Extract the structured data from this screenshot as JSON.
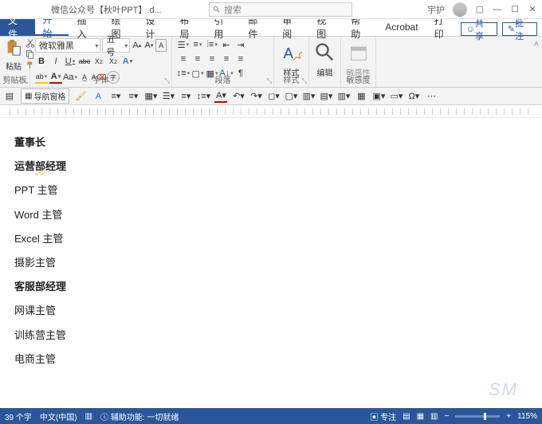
{
  "titlebar": {
    "doc_title": "微信公众号【秋叶PPT】.d...",
    "search_placeholder": "搜索",
    "user_label": "宇护"
  },
  "tabs": {
    "file": "文件",
    "items": [
      "开始",
      "插入",
      "绘图",
      "设计",
      "布局",
      "引用",
      "邮件",
      "审阅",
      "视图",
      "帮助",
      "Acrobat",
      "打印"
    ],
    "active_index": 0,
    "share": "共享",
    "comments": "批注"
  },
  "ribbon": {
    "clipboard": {
      "label": "剪贴板",
      "paste": "粘贴"
    },
    "font": {
      "label": "字体",
      "name": "微软雅黑",
      "size": "五号",
      "bold": "B",
      "italic": "I",
      "underline": "U",
      "strike": "abc",
      "sub": "X₂",
      "sup": "X²",
      "tools": "Aa",
      "clear": "A"
    },
    "paragraph": {
      "label": "段落"
    },
    "styles": {
      "label": "样式",
      "text": "样式"
    },
    "editing": {
      "label": "编辑",
      "text": "编辑"
    },
    "sensitivity": {
      "label": "敏感度",
      "text": "敏感性"
    }
  },
  "qat": {
    "nav_pane": "导航窗格"
  },
  "document": {
    "lines": [
      {
        "text": "董事长",
        "bold": true
      },
      {
        "text": "运营部经理",
        "bold": true,
        "squiggle_range": [
          2,
          3
        ]
      },
      {
        "text": "PPT 主管",
        "bold": false
      },
      {
        "text": "Word 主管",
        "bold": false
      },
      {
        "text": "Excel 主管",
        "bold": false
      },
      {
        "text": "摄影主管",
        "bold": false
      },
      {
        "text": "客服部经理",
        "bold": true
      },
      {
        "text": "网课主管",
        "bold": false
      },
      {
        "text": "训练营主管",
        "bold": false
      },
      {
        "text": "电商主管",
        "bold": false
      }
    ]
  },
  "statusbar": {
    "words": "39 个字",
    "lang": "中文(中国)",
    "a11y": "辅助功能: 一切就绪",
    "focus": "专注",
    "zoom": "115%"
  },
  "watermark": "SM"
}
